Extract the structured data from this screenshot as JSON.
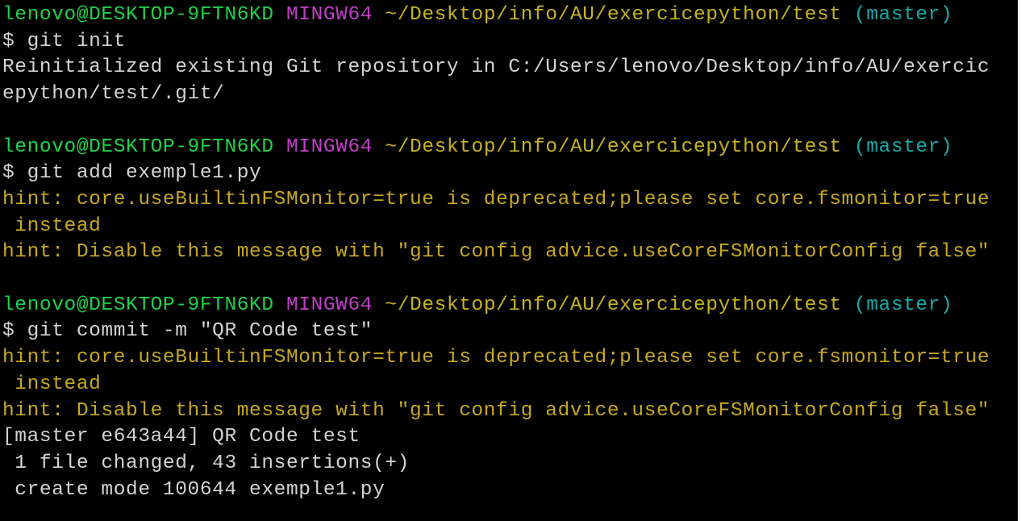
{
  "colors": {
    "background": "#000000",
    "default": "#d3d3d3",
    "prompt_user": "#1fd14a",
    "msystem": "#c03fc7",
    "path": "#c7b31f",
    "branch": "#16a9a9",
    "hint": "#c7a81f"
  },
  "terminal": {
    "lines": [
      {
        "segments": [
          {
            "text": "lenovo@DESKTOP-9FTN6KD",
            "color": "prompt_user",
            "name": "prompt-user-host"
          },
          {
            "text": " ",
            "color": "default",
            "name": "prompt-spacer"
          },
          {
            "text": "MINGW64",
            "color": "msystem",
            "name": "prompt-msystem"
          },
          {
            "text": " ",
            "color": "default",
            "name": "prompt-spacer"
          },
          {
            "text": "~/Desktop/info/AU/exercicepython/test",
            "color": "path",
            "name": "prompt-path"
          },
          {
            "text": " ",
            "color": "default",
            "name": "prompt-spacer"
          },
          {
            "text": "(master)",
            "color": "branch",
            "name": "prompt-branch"
          }
        ]
      },
      {
        "segments": [
          {
            "text": "$ git init",
            "color": "default",
            "name": "command-text"
          }
        ]
      },
      {
        "segments": [
          {
            "text": "Reinitialized existing Git repository in C:/Users/lenovo/Desktop/info/AU/exercic",
            "color": "default",
            "name": "output-text"
          }
        ]
      },
      {
        "segments": [
          {
            "text": "epython/test/.git/",
            "color": "default",
            "name": "output-text"
          }
        ]
      },
      {
        "segments": []
      },
      {
        "segments": [
          {
            "text": "lenovo@DESKTOP-9FTN6KD",
            "color": "prompt_user",
            "name": "prompt-user-host"
          },
          {
            "text": " ",
            "color": "default",
            "name": "prompt-spacer"
          },
          {
            "text": "MINGW64",
            "color": "msystem",
            "name": "prompt-msystem"
          },
          {
            "text": " ",
            "color": "default",
            "name": "prompt-spacer"
          },
          {
            "text": "~/Desktop/info/AU/exercicepython/test",
            "color": "path",
            "name": "prompt-path"
          },
          {
            "text": " ",
            "color": "default",
            "name": "prompt-spacer"
          },
          {
            "text": "(master)",
            "color": "branch",
            "name": "prompt-branch"
          }
        ]
      },
      {
        "segments": [
          {
            "text": "$ git add exemple1.py",
            "color": "default",
            "name": "command-text"
          }
        ]
      },
      {
        "segments": [
          {
            "text": "hint: core.useBuiltinFSMonitor=true is deprecated;please set core.fsmonitor=true",
            "color": "hint",
            "name": "hint-text"
          }
        ]
      },
      {
        "segments": [
          {
            "text": " instead",
            "color": "hint",
            "name": "hint-text"
          }
        ]
      },
      {
        "segments": [
          {
            "text": "hint: Disable this message with \"git config advice.useCoreFSMonitorConfig false\"",
            "color": "hint",
            "name": "hint-text"
          }
        ]
      },
      {
        "segments": []
      },
      {
        "segments": [
          {
            "text": "lenovo@DESKTOP-9FTN6KD",
            "color": "prompt_user",
            "name": "prompt-user-host"
          },
          {
            "text": " ",
            "color": "default",
            "name": "prompt-spacer"
          },
          {
            "text": "MINGW64",
            "color": "msystem",
            "name": "prompt-msystem"
          },
          {
            "text": " ",
            "color": "default",
            "name": "prompt-spacer"
          },
          {
            "text": "~/Desktop/info/AU/exercicepython/test",
            "color": "path",
            "name": "prompt-path"
          },
          {
            "text": " ",
            "color": "default",
            "name": "prompt-spacer"
          },
          {
            "text": "(master)",
            "color": "branch",
            "name": "prompt-branch"
          }
        ]
      },
      {
        "segments": [
          {
            "text": "$ git commit -m \"QR Code test\"",
            "color": "default",
            "name": "command-text"
          }
        ]
      },
      {
        "segments": [
          {
            "text": "hint: core.useBuiltinFSMonitor=true is deprecated;please set core.fsmonitor=true",
            "color": "hint",
            "name": "hint-text"
          }
        ]
      },
      {
        "segments": [
          {
            "text": " instead",
            "color": "hint",
            "name": "hint-text"
          }
        ]
      },
      {
        "segments": [
          {
            "text": "hint: Disable this message with \"git config advice.useCoreFSMonitorConfig false\"",
            "color": "hint",
            "name": "hint-text"
          }
        ]
      },
      {
        "segments": [
          {
            "text": "[master e643a44] QR Code test",
            "color": "default",
            "name": "output-text"
          }
        ]
      },
      {
        "segments": [
          {
            "text": " 1 file changed, 43 insertions(+)",
            "color": "default",
            "name": "output-text"
          }
        ]
      },
      {
        "segments": [
          {
            "text": " create mode 100644 exemple1.py",
            "color": "default",
            "name": "output-text"
          }
        ]
      }
    ]
  }
}
